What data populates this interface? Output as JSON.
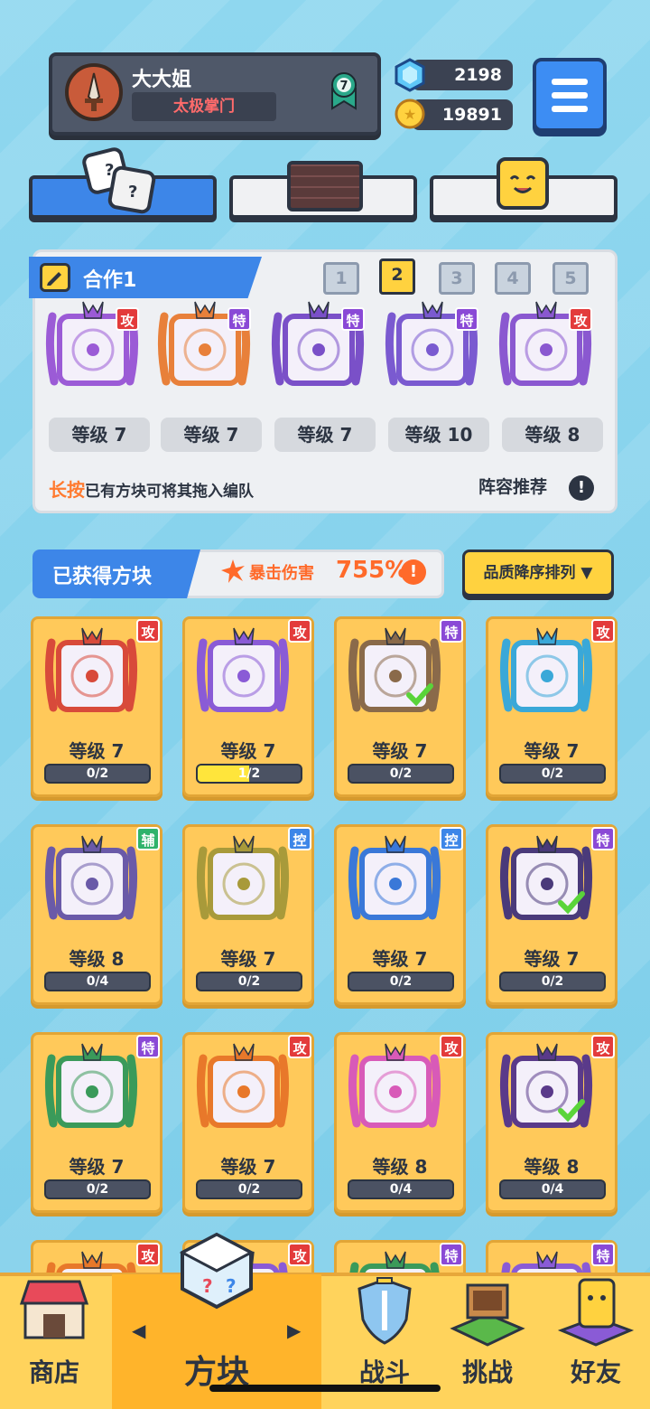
{
  "profile": {
    "name": "大大姐",
    "title": "太极掌门",
    "rank": "7"
  },
  "currency": {
    "gems": "2198",
    "coins": "19891"
  },
  "team": {
    "name": "合作1",
    "pages": [
      "1",
      "2",
      "3",
      "4",
      "5"
    ],
    "selected_page": "2",
    "cards": [
      {
        "badge": "攻",
        "level": "等级 7",
        "color": "#9b5bd6"
      },
      {
        "badge": "特",
        "level": "等级 7",
        "color": "#e8803a"
      },
      {
        "badge": "特",
        "level": "等级 7",
        "color": "#7a50c8"
      },
      {
        "badge": "特",
        "level": "等级 10",
        "color": "#7a5ad0"
      },
      {
        "badge": "攻",
        "level": "等级 8",
        "color": "#8a58d0"
      }
    ],
    "hint_key": "长按",
    "hint_rest": "已有方块可将其拖入编队",
    "recommend": "阵容推荐",
    "recommend_icon": "!"
  },
  "obtained": {
    "title": "已获得方块",
    "crit_label": "暴击伤害",
    "crit_value": "755%",
    "crit_icon": "!",
    "sort_label": "品质降序排列 ▼"
  },
  "cards": [
    {
      "badge": "攻",
      "type": "atk",
      "level": "等级 7",
      "progress": "0/2",
      "fill": 0,
      "color": "#d84a3a",
      "checked": false
    },
    {
      "badge": "攻",
      "type": "atk",
      "level": "等级 7",
      "progress": "1/2",
      "fill": 0.5,
      "color": "#8a5bd6",
      "checked": false
    },
    {
      "badge": "特",
      "type": "spc",
      "level": "等级 7",
      "progress": "0/2",
      "fill": 0,
      "color": "#8a6a4a",
      "checked": true
    },
    {
      "badge": "攻",
      "type": "atk",
      "level": "等级 7",
      "progress": "0/2",
      "fill": 0,
      "color": "#3aa8d8",
      "checked": false
    },
    {
      "badge": "辅",
      "type": "sup",
      "level": "等级 8",
      "progress": "0/4",
      "fill": 0,
      "color": "#6a5aa8",
      "checked": false
    },
    {
      "badge": "控",
      "type": "ctl",
      "level": "等级 7",
      "progress": "0/2",
      "fill": 0,
      "color": "#a89a3a",
      "checked": false
    },
    {
      "badge": "控",
      "type": "ctl",
      "level": "等级 7",
      "progress": "0/2",
      "fill": 0,
      "color": "#3a78d8",
      "checked": false
    },
    {
      "badge": "特",
      "type": "spc",
      "level": "等级 7",
      "progress": "0/2",
      "fill": 0,
      "color": "#4a3a7a",
      "checked": true
    },
    {
      "badge": "特",
      "type": "spc",
      "level": "等级 7",
      "progress": "0/2",
      "fill": 0,
      "color": "#3a9a5a",
      "checked": false
    },
    {
      "badge": "攻",
      "type": "atk",
      "level": "等级 7",
      "progress": "0/2",
      "fill": 0,
      "color": "#e8782a",
      "checked": false
    },
    {
      "badge": "攻",
      "type": "atk",
      "level": "等级 8",
      "progress": "0/4",
      "fill": 0,
      "color": "#d85ab8",
      "checked": false
    },
    {
      "badge": "攻",
      "type": "atk",
      "level": "等级 8",
      "progress": "0/4",
      "fill": 0,
      "color": "#5a3a8a",
      "checked": true
    },
    {
      "badge": "攻",
      "type": "atk",
      "color": "#e8782a"
    },
    {
      "badge": "攻",
      "type": "atk",
      "color": "#8a5bd6"
    },
    {
      "badge": "特",
      "type": "spc",
      "color": "#3a9a5a"
    },
    {
      "badge": "特",
      "type": "spc",
      "color": "#8a5bd6"
    }
  ],
  "nav": {
    "shop": "商店",
    "blocks": "方块",
    "battle": "战斗",
    "challenge": "挑战",
    "friends": "好友",
    "prev_arrow": "◀",
    "next_arrow": "▶"
  }
}
